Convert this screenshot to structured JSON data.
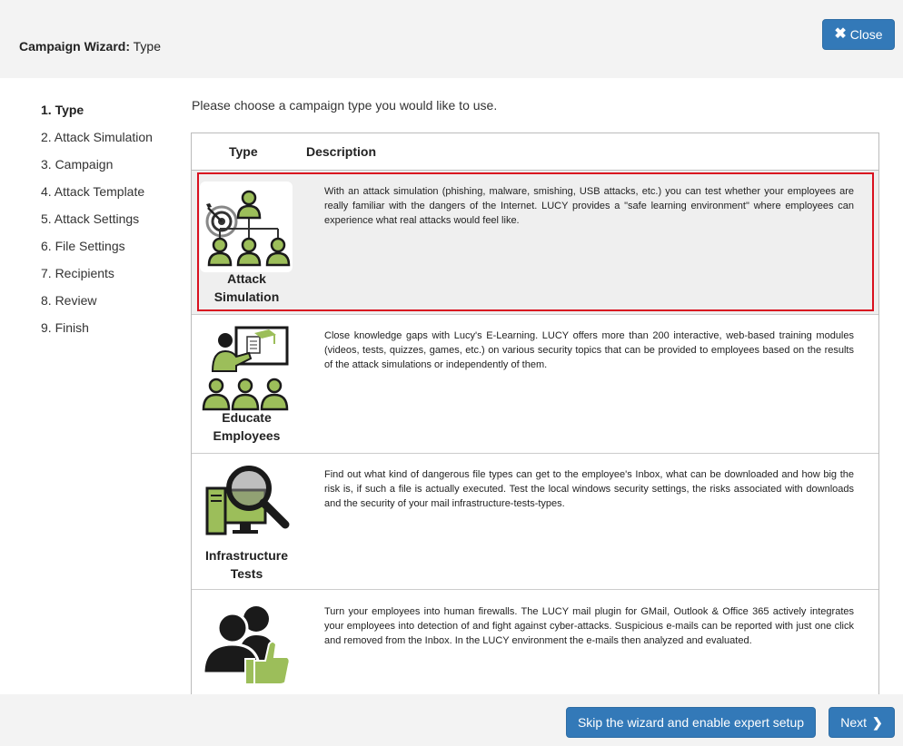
{
  "header": {
    "title_prefix": "Campaign Wizard:",
    "title_step": "Type",
    "close_label": "Close"
  },
  "steps": [
    "1. Type",
    "2. Attack Simulation",
    "3. Campaign",
    "4. Attack Template",
    "5. Attack Settings",
    "6. File Settings",
    "7. Recipients",
    "8. Review",
    "9. Finish"
  ],
  "active_step": 0,
  "intro": "Please choose a campaign type you would like to use.",
  "table": {
    "col_type": "Type",
    "col_description": "Description",
    "rows": [
      {
        "icon": "target-org-chart-icon",
        "label_line1": "Attack",
        "label_line2": "Simulation",
        "description": "With an attack simulation (phishing, malware, smishing, USB attacks, etc.) you can test whether your employees are really familiar with the dangers of the Internet. LUCY provides a \"safe learning environment\" where employees can experience what real attacks would feel like."
      },
      {
        "icon": "presentation-training-icon",
        "label_line1": "Educate",
        "label_line2": "Employees",
        "description": "Close knowledge gaps with Lucy's E-Learning. LUCY offers more than 200 interactive, web-based training modules (videos, tests, quizzes, games, etc.) on various security topics that can be provided to employees based on the results of the attack simulations or independently of them."
      },
      {
        "icon": "computer-magnifier-icon",
        "label_line1": "Infrastructure",
        "label_line2": "Tests",
        "description": "Find out what kind of dangerous file types can get to the employee's Inbox, what can be downloaded and how big the risk is, if such a file is actually executed. Test the local windows security settings, the risks associated with downloads and the security of your mail infrastructure-tests-types."
      },
      {
        "icon": "users-thumbs-up-icon",
        "label_line1": "",
        "label_line2": "",
        "description": "Turn your employees into human firewalls. The LUCY mail plugin for GMail, Outlook & Office 365 actively integrates your employees into detection of and fight against cyber-attacks. Suspicious e-mails can be reported with just one click and removed from the Inbox. In the LUCY environment the e-mails then analyzed and evaluated."
      }
    ]
  },
  "footer": {
    "skip_label": "Skip the wizard and enable expert setup",
    "next_label": "Next"
  },
  "colors": {
    "primary": "#3379b8",
    "highlight": "#d9101f",
    "icon_green": "#9cbe5a",
    "icon_dark": "#1a1a1a"
  }
}
